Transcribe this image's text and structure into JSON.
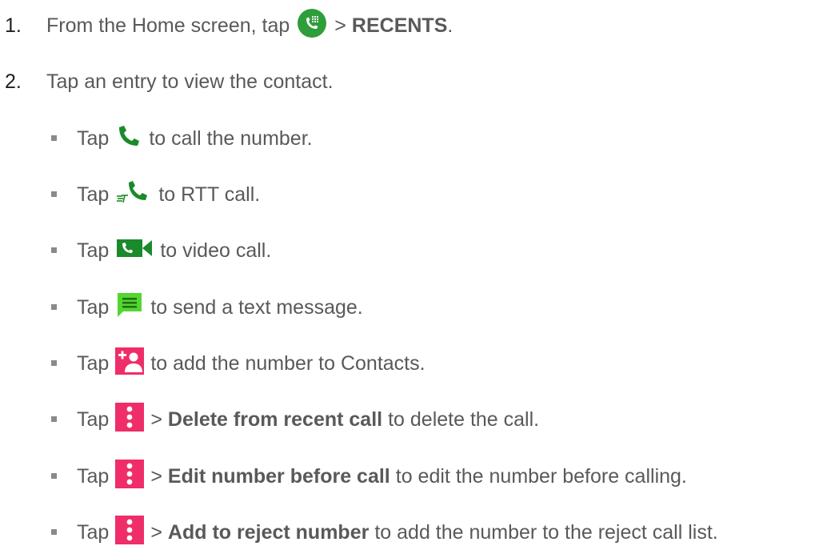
{
  "steps": [
    {
      "number": "1.",
      "before": "From the Home screen, tap",
      "icon": "phone-dialpad-icon",
      "after_sep": ">",
      "bold": "RECENTS",
      "end": "."
    },
    {
      "number": "2.",
      "text": "Tap an entry to view the contact."
    }
  ],
  "sub_items": [
    {
      "tap": "Tap",
      "icon": "phone-call-icon",
      "text": "to call the number."
    },
    {
      "tap": "Tap",
      "icon": "rtt-call-icon",
      "text": "to RTT call."
    },
    {
      "tap": "Tap",
      "icon": "video-call-icon",
      "text": "to video call."
    },
    {
      "tap": "Tap",
      "icon": "message-icon",
      "text": "to send a text message."
    },
    {
      "tap": "Tap",
      "icon": "add-contact-icon",
      "text": "to add the number to Contacts."
    },
    {
      "tap": "Tap",
      "icon": "more-options-icon",
      "sep": ">",
      "bold": "Delete from recent call",
      "text": "to delete the call."
    },
    {
      "tap": "Tap",
      "icon": "more-options-icon",
      "sep": ">",
      "bold": "Edit number before call",
      "text": "to edit the number before calling."
    },
    {
      "tap": "Tap",
      "icon": "more-options-icon",
      "sep": ">",
      "bold": "Add to reject number",
      "text": "to add the number to the reject call list."
    }
  ],
  "colors": {
    "green": "#1a8a2a",
    "icon_green": "#2e9e3a",
    "bright_green": "#53d630",
    "pink": "#ef2d68",
    "text": "#595959",
    "number": "#1f1f1f"
  }
}
